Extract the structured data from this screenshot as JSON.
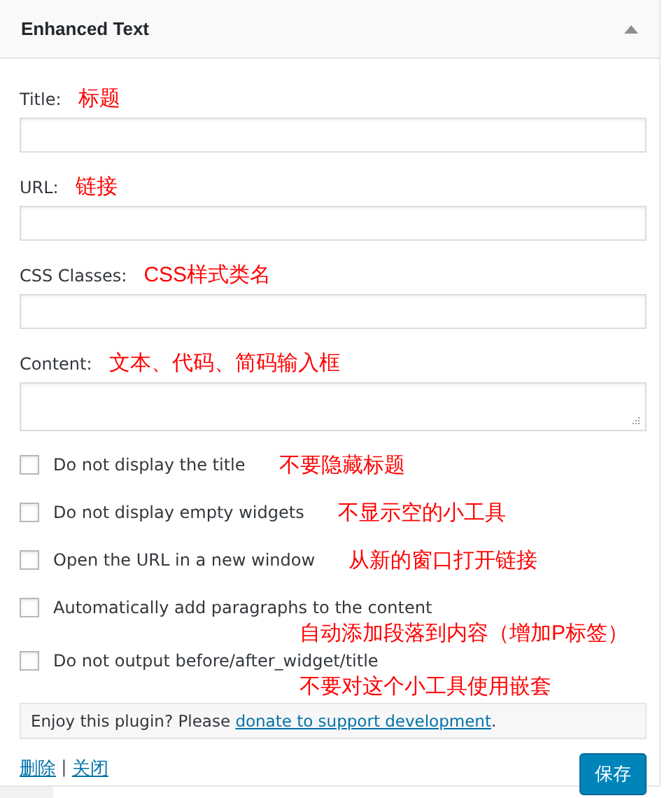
{
  "widget": {
    "title": "Enhanced Text",
    "expanded": true
  },
  "fields": [
    {
      "kind": "input",
      "label": "Title:",
      "note": "标题"
    },
    {
      "kind": "input",
      "label": "URL:",
      "note": "链接"
    },
    {
      "kind": "input",
      "label": "CSS Classes:",
      "note": "CSS样式类名"
    },
    {
      "kind": "textarea",
      "label": "Content:",
      "note": "文本、代码、简码输入框"
    }
  ],
  "options": [
    {
      "label": "Do not display the title",
      "checked": false,
      "note": "不要隐藏标题",
      "note_below": false
    },
    {
      "label": "Do not display empty widgets",
      "checked": false,
      "note": "不显示空的小工具",
      "note_below": false
    },
    {
      "label": "Open the URL in a new window",
      "checked": false,
      "note": "从新的窗口打开链接",
      "note_below": false
    },
    {
      "label": "Automatically add paragraphs to the content",
      "checked": false,
      "note": "自动添加段落到内容（增加P标签）",
      "note_below": true
    },
    {
      "label": "Do not output before/after_widget/title",
      "checked": false,
      "note": "不要对这个小工具使用嵌套",
      "note_below": true
    }
  ],
  "donate": {
    "text": "Enjoy this plugin? Please ",
    "link": "donate to support development",
    "end": "."
  },
  "actions": {
    "delete": "删除",
    "separator": "|",
    "close": "关闭",
    "save": "保存"
  }
}
